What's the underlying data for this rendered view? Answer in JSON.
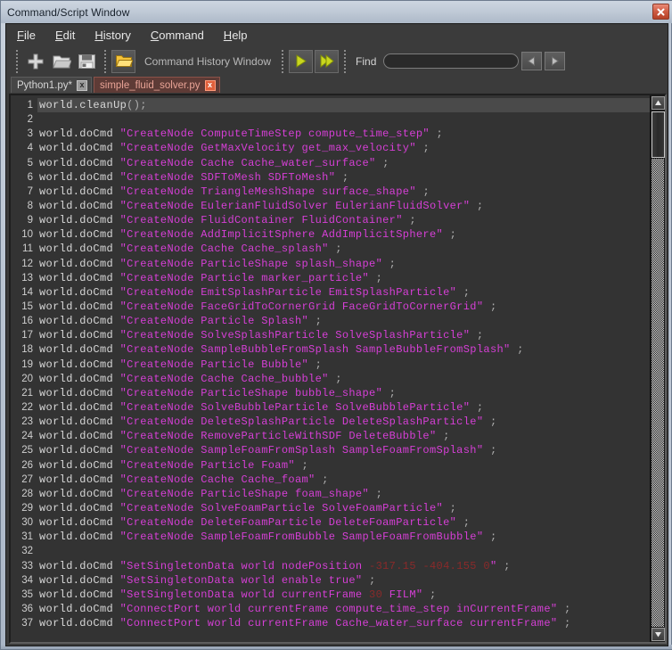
{
  "window": {
    "title": "Command/Script Window",
    "close_label": "x"
  },
  "menubar": {
    "items": [
      {
        "mnemonic": "F",
        "rest": "ile"
      },
      {
        "mnemonic": "E",
        "rest": "dit"
      },
      {
        "mnemonic": "H",
        "rest": "istory"
      },
      {
        "mnemonic": "C",
        "rest": "ommand"
      },
      {
        "mnemonic": "H",
        "rest": "elp"
      }
    ]
  },
  "toolbar": {
    "new_icon": "plus-icon",
    "open_icon": "folder-icon",
    "save_icon": "save-icon",
    "history_icon": "yellow-folder-icon",
    "label": "Command History Window",
    "execute_icon": "play-icon",
    "execute_all_icon": "play-all-icon",
    "find_label": "Find",
    "find_value": "",
    "find_placeholder": "",
    "prev_icon": "triangle-left-icon",
    "next_icon": "triangle-right-icon"
  },
  "tabs": [
    {
      "label": "Python1.py*",
      "active": false,
      "close": "x"
    },
    {
      "label": "simple_fluid_solver.py",
      "active": true,
      "close": "x"
    }
  ],
  "editor": {
    "lines": [
      {
        "n": "1",
        "segments": [
          {
            "t": "plain",
            "s": "world.cleanUp"
          },
          {
            "t": "punct",
            "s": "();"
          }
        ],
        "current": true
      },
      {
        "n": "2",
        "segments": [],
        "current": false
      },
      {
        "n": "3",
        "segments": [
          {
            "t": "plain",
            "s": "world.doCmd "
          },
          {
            "t": "str",
            "s": "\"CreateNode ComputeTimeStep compute_time_step\""
          },
          {
            "t": "punct",
            "s": " ;"
          }
        ],
        "current": false
      },
      {
        "n": "4",
        "segments": [
          {
            "t": "plain",
            "s": "world.doCmd "
          },
          {
            "t": "str",
            "s": "\"CreateNode GetMaxVelocity get_max_velocity\""
          },
          {
            "t": "punct",
            "s": " ;"
          }
        ],
        "current": false
      },
      {
        "n": "5",
        "segments": [
          {
            "t": "plain",
            "s": "world.doCmd "
          },
          {
            "t": "str",
            "s": "\"CreateNode Cache Cache_water_surface\""
          },
          {
            "t": "punct",
            "s": " ;"
          }
        ],
        "current": false
      },
      {
        "n": "6",
        "segments": [
          {
            "t": "plain",
            "s": "world.doCmd "
          },
          {
            "t": "str",
            "s": "\"CreateNode SDFToMesh SDFToMesh\""
          },
          {
            "t": "punct",
            "s": " ;"
          }
        ],
        "current": false
      },
      {
        "n": "7",
        "segments": [
          {
            "t": "plain",
            "s": "world.doCmd "
          },
          {
            "t": "str",
            "s": "\"CreateNode TriangleMeshShape surface_shape\""
          },
          {
            "t": "punct",
            "s": " ;"
          }
        ],
        "current": false
      },
      {
        "n": "8",
        "segments": [
          {
            "t": "plain",
            "s": "world.doCmd "
          },
          {
            "t": "str",
            "s": "\"CreateNode EulerianFluidSolver EulerianFluidSolver\""
          },
          {
            "t": "punct",
            "s": " ;"
          }
        ],
        "current": false
      },
      {
        "n": "9",
        "segments": [
          {
            "t": "plain",
            "s": "world.doCmd "
          },
          {
            "t": "str",
            "s": "\"CreateNode FluidContainer FluidContainer\""
          },
          {
            "t": "punct",
            "s": " ;"
          }
        ],
        "current": false
      },
      {
        "n": "10",
        "segments": [
          {
            "t": "plain",
            "s": "world.doCmd "
          },
          {
            "t": "str",
            "s": "\"CreateNode AddImplicitSphere AddImplicitSphere\""
          },
          {
            "t": "punct",
            "s": " ;"
          }
        ],
        "current": false
      },
      {
        "n": "11",
        "segments": [
          {
            "t": "plain",
            "s": "world.doCmd "
          },
          {
            "t": "str",
            "s": "\"CreateNode Cache Cache_splash\""
          },
          {
            "t": "punct",
            "s": " ;"
          }
        ],
        "current": false
      },
      {
        "n": "12",
        "segments": [
          {
            "t": "plain",
            "s": "world.doCmd "
          },
          {
            "t": "str",
            "s": "\"CreateNode ParticleShape splash_shape\""
          },
          {
            "t": "punct",
            "s": " ;"
          }
        ],
        "current": false
      },
      {
        "n": "13",
        "segments": [
          {
            "t": "plain",
            "s": "world.doCmd "
          },
          {
            "t": "str",
            "s": "\"CreateNode Particle marker_particle\""
          },
          {
            "t": "punct",
            "s": " ;"
          }
        ],
        "current": false
      },
      {
        "n": "14",
        "segments": [
          {
            "t": "plain",
            "s": "world.doCmd "
          },
          {
            "t": "str",
            "s": "\"CreateNode EmitSplashParticle EmitSplashParticle\""
          },
          {
            "t": "punct",
            "s": " ;"
          }
        ],
        "current": false
      },
      {
        "n": "15",
        "segments": [
          {
            "t": "plain",
            "s": "world.doCmd "
          },
          {
            "t": "str",
            "s": "\"CreateNode FaceGridToCornerGrid FaceGridToCornerGrid\""
          },
          {
            "t": "punct",
            "s": " ;"
          }
        ],
        "current": false
      },
      {
        "n": "16",
        "segments": [
          {
            "t": "plain",
            "s": "world.doCmd "
          },
          {
            "t": "str",
            "s": "\"CreateNode Particle Splash\""
          },
          {
            "t": "punct",
            "s": " ;"
          }
        ],
        "current": false
      },
      {
        "n": "17",
        "segments": [
          {
            "t": "plain",
            "s": "world.doCmd "
          },
          {
            "t": "str",
            "s": "\"CreateNode SolveSplashParticle SolveSplashParticle\""
          },
          {
            "t": "punct",
            "s": " ;"
          }
        ],
        "current": false
      },
      {
        "n": "18",
        "segments": [
          {
            "t": "plain",
            "s": "world.doCmd "
          },
          {
            "t": "str",
            "s": "\"CreateNode SampleBubbleFromSplash SampleBubbleFromSplash\""
          },
          {
            "t": "punct",
            "s": " ;"
          }
        ],
        "current": false
      },
      {
        "n": "19",
        "segments": [
          {
            "t": "plain",
            "s": "world.doCmd "
          },
          {
            "t": "str",
            "s": "\"CreateNode Particle Bubble\""
          },
          {
            "t": "punct",
            "s": " ;"
          }
        ],
        "current": false
      },
      {
        "n": "20",
        "segments": [
          {
            "t": "plain",
            "s": "world.doCmd "
          },
          {
            "t": "str",
            "s": "\"CreateNode Cache Cache_bubble\""
          },
          {
            "t": "punct",
            "s": " ;"
          }
        ],
        "current": false
      },
      {
        "n": "21",
        "segments": [
          {
            "t": "plain",
            "s": "world.doCmd "
          },
          {
            "t": "str",
            "s": "\"CreateNode ParticleShape bubble_shape\""
          },
          {
            "t": "punct",
            "s": " ;"
          }
        ],
        "current": false
      },
      {
        "n": "22",
        "segments": [
          {
            "t": "plain",
            "s": "world.doCmd "
          },
          {
            "t": "str",
            "s": "\"CreateNode SolveBubbleParticle SolveBubbleParticle\""
          },
          {
            "t": "punct",
            "s": " ;"
          }
        ],
        "current": false
      },
      {
        "n": "23",
        "segments": [
          {
            "t": "plain",
            "s": "world.doCmd "
          },
          {
            "t": "str",
            "s": "\"CreateNode DeleteSplashParticle DeleteSplashParticle\""
          },
          {
            "t": "punct",
            "s": " ;"
          }
        ],
        "current": false
      },
      {
        "n": "24",
        "segments": [
          {
            "t": "plain",
            "s": "world.doCmd "
          },
          {
            "t": "str",
            "s": "\"CreateNode RemoveParticleWithSDF DeleteBubble\""
          },
          {
            "t": "punct",
            "s": " ;"
          }
        ],
        "current": false
      },
      {
        "n": "25",
        "segments": [
          {
            "t": "plain",
            "s": "world.doCmd "
          },
          {
            "t": "str",
            "s": "\"CreateNode SampleFoamFromSplash SampleFoamFromSplash\""
          },
          {
            "t": "punct",
            "s": " ;"
          }
        ],
        "current": false
      },
      {
        "n": "26",
        "segments": [
          {
            "t": "plain",
            "s": "world.doCmd "
          },
          {
            "t": "str",
            "s": "\"CreateNode Particle Foam\""
          },
          {
            "t": "punct",
            "s": " ;"
          }
        ],
        "current": false
      },
      {
        "n": "27",
        "segments": [
          {
            "t": "plain",
            "s": "world.doCmd "
          },
          {
            "t": "str",
            "s": "\"CreateNode Cache Cache_foam\""
          },
          {
            "t": "punct",
            "s": " ;"
          }
        ],
        "current": false
      },
      {
        "n": "28",
        "segments": [
          {
            "t": "plain",
            "s": "world.doCmd "
          },
          {
            "t": "str",
            "s": "\"CreateNode ParticleShape foam_shape\""
          },
          {
            "t": "punct",
            "s": " ;"
          }
        ],
        "current": false
      },
      {
        "n": "29",
        "segments": [
          {
            "t": "plain",
            "s": "world.doCmd "
          },
          {
            "t": "str",
            "s": "\"CreateNode SolveFoamParticle SolveFoamParticle\""
          },
          {
            "t": "punct",
            "s": " ;"
          }
        ],
        "current": false
      },
      {
        "n": "30",
        "segments": [
          {
            "t": "plain",
            "s": "world.doCmd "
          },
          {
            "t": "str",
            "s": "\"CreateNode DeleteFoamParticle DeleteFoamParticle\""
          },
          {
            "t": "punct",
            "s": " ;"
          }
        ],
        "current": false
      },
      {
        "n": "31",
        "segments": [
          {
            "t": "plain",
            "s": "world.doCmd "
          },
          {
            "t": "str",
            "s": "\"CreateNode SampleFoamFromBubble SampleFoamFromBubble\""
          },
          {
            "t": "punct",
            "s": " ;"
          }
        ],
        "current": false
      },
      {
        "n": "32",
        "segments": [],
        "current": false
      },
      {
        "n": "33",
        "segments": [
          {
            "t": "plain",
            "s": "world.doCmd "
          },
          {
            "t": "str",
            "s": "\"SetSingletonData world nodePosition "
          },
          {
            "t": "num",
            "s": "-317.15 -404.155 0"
          },
          {
            "t": "str",
            "s": "\""
          },
          {
            "t": "punct",
            "s": " ;"
          }
        ],
        "current": false
      },
      {
        "n": "34",
        "segments": [
          {
            "t": "plain",
            "s": "world.doCmd "
          },
          {
            "t": "str",
            "s": "\"SetSingletonData world enable true\""
          },
          {
            "t": "punct",
            "s": " ;"
          }
        ],
        "current": false
      },
      {
        "n": "35",
        "segments": [
          {
            "t": "plain",
            "s": "world.doCmd "
          },
          {
            "t": "str",
            "s": "\"SetSingletonData world currentFrame "
          },
          {
            "t": "num",
            "s": "30"
          },
          {
            "t": "str",
            "s": " FILM\""
          },
          {
            "t": "punct",
            "s": " ;"
          }
        ],
        "current": false
      },
      {
        "n": "36",
        "segments": [
          {
            "t": "plain",
            "s": "world.doCmd "
          },
          {
            "t": "str",
            "s": "\"ConnectPort world currentFrame compute_time_step inCurrentFrame\""
          },
          {
            "t": "punct",
            "s": " ;"
          }
        ],
        "current": false
      },
      {
        "n": "37",
        "segments": [
          {
            "t": "plain",
            "s": "world.doCmd "
          },
          {
            "t": "str",
            "s": "\"ConnectPort world currentFrame Cache_water_surface currentFrame\""
          },
          {
            "t": "punct",
            "s": " ;"
          }
        ],
        "current": false
      }
    ]
  },
  "scrollbar": {
    "up_icon": "arrow-up-icon",
    "down_icon": "arrow-down-icon"
  },
  "colors": {
    "string": "#d63fd6",
    "number": "#8a2a2a",
    "plain": "#d8d8d8",
    "editor_bg": "#333333",
    "chrome_bg": "#3b3b3b",
    "active_tab": "#5e3b36",
    "close_red": "#cf5c44"
  }
}
